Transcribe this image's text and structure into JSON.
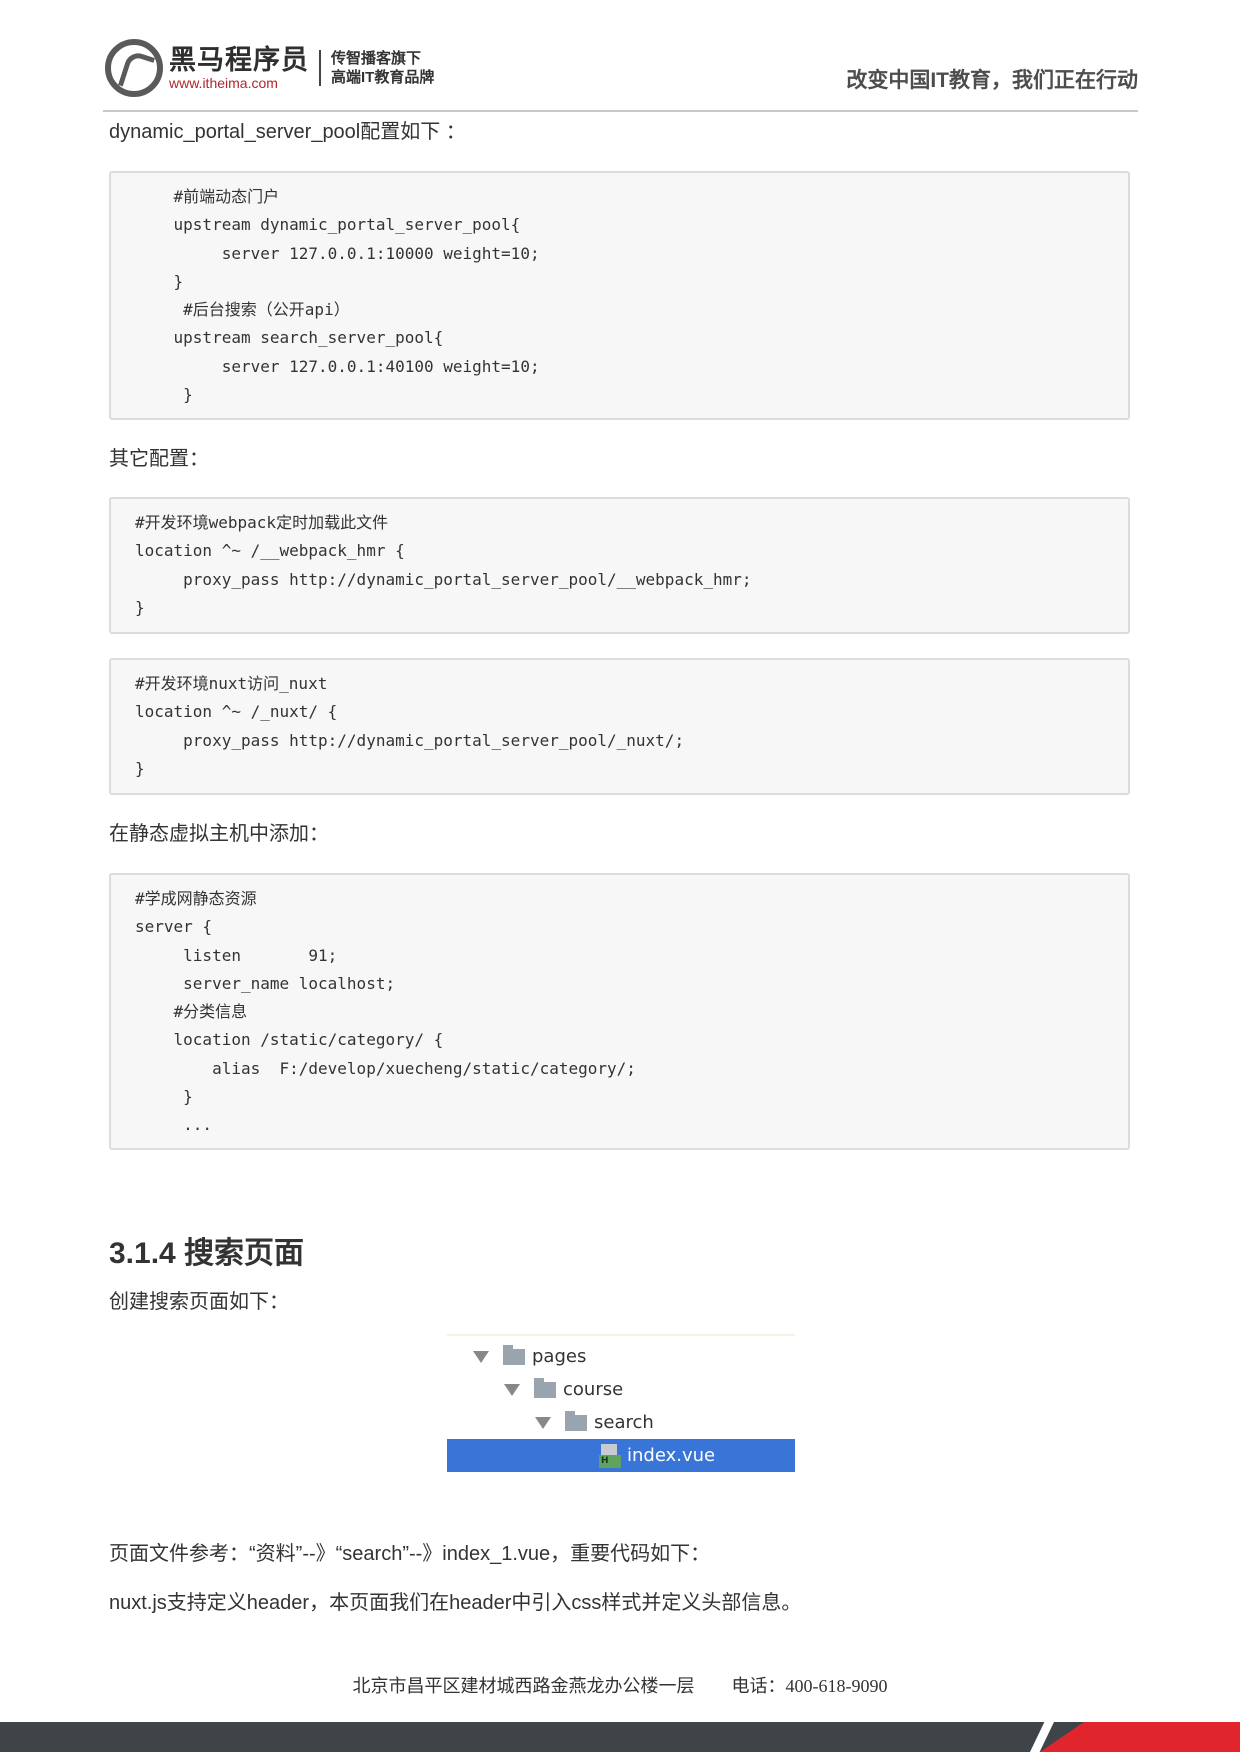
{
  "header": {
    "brand_name": "黑马程序员",
    "brand_url": "www.itheima.com",
    "slogan_line1": "传智播客旗下",
    "slogan_line2": "高端IT教育品牌",
    "tagline": "改变中国IT教育，我们正在行动"
  },
  "content": {
    "intro": "dynamic_portal_server_pool配置如下 ：",
    "code1": "    #前端动态门户\n    upstream dynamic_portal_server_pool{\n         server 127.0.0.1:10000 weight=10;\n    }\n     #后台搜索（公开api）\n    upstream search_server_pool{\n         server 127.0.0.1:40100 weight=10;\n     }",
    "other_config": "其它配置：",
    "code2": "#开发环境webpack定时加载此文件\nlocation ^~ /__webpack_hmr {\n     proxy_pass http://dynamic_portal_server_pool/__webpack_hmr;\n}",
    "code3": "#开发环境nuxt访问_nuxt\nlocation ^~ /_nuxt/ {\n     proxy_pass http://dynamic_portal_server_pool/_nuxt/;\n}",
    "static_add": "在静态虚拟主机中添加：",
    "code4": "#学成网静态资源\nserver {\n     listen       91;\n     server_name localhost;\n    #分类信息\n    location /static/category/ {\n        alias  F:/develop/xuecheng/static/category/;\n     }\n     ...",
    "section_title": "3.1.4 搜索页面",
    "create_page": "创建搜索页面如下：",
    "ref_line": "页面文件参考：“资料”--》“search”--》index_1.vue，重要代码如下：",
    "nuxt_line": "nuxt.js支持定义header，本页面我们在header中引入css样式并定义头部信息。"
  },
  "file_tree": [
    {
      "label": "pages",
      "type": "folder",
      "expanded": true
    },
    {
      "label": "course",
      "type": "folder",
      "expanded": true
    },
    {
      "label": "search",
      "type": "folder",
      "expanded": true
    },
    {
      "label": "index.vue",
      "type": "file",
      "selected": true
    }
  ],
  "footer": {
    "address": "北京市昌平区建材城西路金燕龙办公楼一层",
    "phone": "电话：400-618-9090"
  },
  "colors": {
    "brand_red": "#e0262c",
    "footer_dark": "#3e4447",
    "selection_blue": "#3875d7",
    "code_bg": "#f7f7f7"
  }
}
